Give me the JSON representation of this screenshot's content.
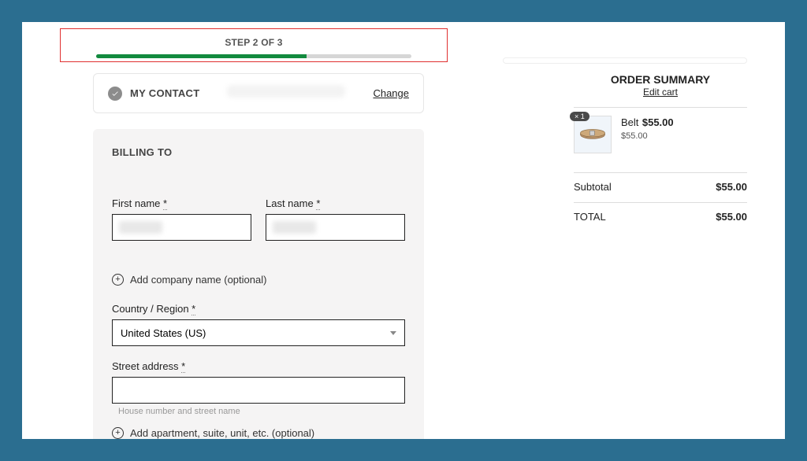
{
  "step": {
    "label": "STEP 2 OF 3",
    "percent": "66.66%"
  },
  "contact": {
    "title": "MY CONTACT",
    "change": "Change"
  },
  "billing": {
    "title": "BILLING TO",
    "first_name_label": "First name ",
    "last_name_label": "Last name ",
    "required_mark": "*",
    "add_company": "Add company name (optional)",
    "country_label": "Country / Region ",
    "country_selected": "United States (US)",
    "street_label": "Street address ",
    "street_hint": "House number and street name",
    "add_apartment": "Add apartment, suite, unit, etc. (optional)"
  },
  "summary": {
    "title": "ORDER SUMMARY",
    "edit": "Edit cart",
    "item": {
      "qty_badge": "× 1",
      "name": "Belt",
      "price": "$55.00",
      "unit_price": "$55.00"
    },
    "subtotal_label": "Subtotal",
    "subtotal_value": "$55.00",
    "total_label": "TOTAL",
    "total_value": "$55.00"
  }
}
